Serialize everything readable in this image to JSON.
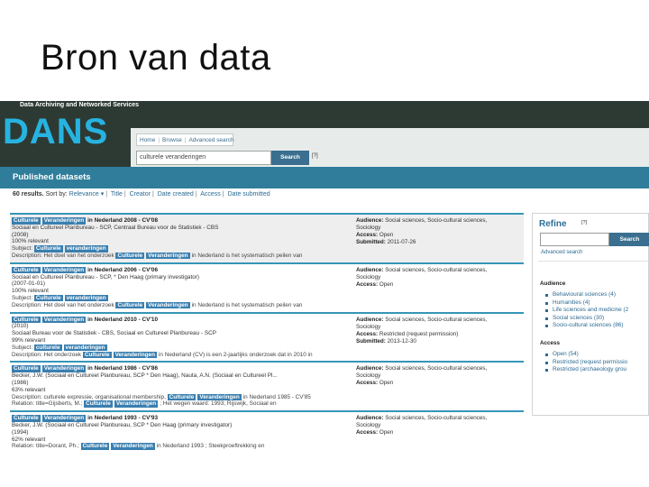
{
  "slide": {
    "title": "Bron van data"
  },
  "app": {
    "tagline": "Data Archiving and Networked Services",
    "logo": "DANS",
    "nav": {
      "home": "Home",
      "browse": "Browse",
      "advanced": "Advanced search"
    },
    "search": {
      "value": "culturele veranderingen",
      "button": "Search",
      "help": "[?]"
    }
  },
  "published": {
    "header": "Published datasets",
    "results_count": "60 results.",
    "sort_label": "Sort by:",
    "sort_options": [
      "Relevance ▾",
      "Title",
      "Creator",
      "Date created",
      "Access",
      "Date submitted"
    ]
  },
  "results": [
    {
      "alt": true,
      "title_tags": [
        "Culturele",
        "Veranderingen"
      ],
      "title_rest": "in Nederland 2008 - CV'08",
      "lines": [
        "Sociaal en Cultureel Planbureau - SCP, Centraal Bureau voor de Statistiek - CBS",
        "(2008)",
        "100% relevant"
      ],
      "subject_label": "Subject:",
      "subject_tags": [
        "Culturele",
        "veranderingen"
      ],
      "desc_label": "Description: Het doel van het onderzoek",
      "desc_tags": [
        "Culturele",
        "Veranderingen"
      ],
      "desc_rest": "in Nederland is het systematisch peilen van",
      "audience": "Social sciences, Socio-cultural sciences,",
      "audience2": "Sociology",
      "access": "Open",
      "submitted": "2011-07-26"
    },
    {
      "alt": false,
      "title_tags": [
        "Culturele",
        "Veranderingen"
      ],
      "title_rest": "in Nederland 2006 - CV'06",
      "lines": [
        "Sociaal en Cultureel Planbureau - SCP, * Den Haag (primary investigator)",
        "(2007-01-01)",
        "100% relevant"
      ],
      "subject_label": "Subject:",
      "subject_tags": [
        "Culturele",
        "veranderingen"
      ],
      "desc_label": "Description: Het doel van het onderzoek",
      "desc_tags": [
        "Culturele",
        "Veranderingen"
      ],
      "desc_rest": "in Nederland is het systematisch peilen van",
      "audience": "Social sciences, Socio-cultural sciences,",
      "audience2": "Sociology",
      "access": "Open",
      "submitted": ""
    },
    {
      "alt": false,
      "title_tags": [
        "Culturele",
        "Veranderingen"
      ],
      "title_rest": "in Nederland 2010 - CV'10",
      "lines": [
        "(2010)",
        "Sociaal Bureau voor de Statistiek - CBS, Sociaal en Cultureel Planbureau - SCP",
        "",
        "99% relevant"
      ],
      "subject_label": "Subject:",
      "subject_tags": [
        "culturele",
        "veranderingen"
      ],
      "desc_label": "Description: Het onderzoek",
      "desc_tags": [
        "Culturele",
        "Veranderingen"
      ],
      "desc_rest": "in Nederland (CV) is een 2-jaarlijks onderzoek dat in 2010 in",
      "audience": "Social sciences, Socio-cultural sciences,",
      "audience2": "Sociology",
      "access": "Restricted (request permission)",
      "submitted": "2013-12-30"
    },
    {
      "alt": false,
      "title_tags": [
        "Culturele",
        "Veranderingen"
      ],
      "title_rest": "in Nederland 1986 - CV'86",
      "lines": [
        "Becker, J.W. (Sociaal en Cultureel Planbureau, SCP * Den Haag), Nauta, A.N. (Sociaal en Cultureel Pl...",
        "(1986)",
        "63% relevant"
      ],
      "subject_label": "Description: culturele expressie, organisational membership,",
      "subject_tags": [
        "Culturele",
        "Veranderingen"
      ],
      "subject_rest": "in Nederland 1985 - CV'85",
      "desc_label": "Relation: title=Gijsberts, M.;",
      "desc_tags": [
        "Culturele",
        "Veranderingen"
      ],
      "desc_rest": "; Het wegen waard: 1993; Rijswijk, Sociaal en",
      "audience": "Social sciences, Socio-cultural sciences,",
      "audience2": "Sociology",
      "access": "Open",
      "submitted": ""
    },
    {
      "alt": false,
      "title_tags": [
        "Culturele",
        "Veranderingen"
      ],
      "title_rest": "in Nederland 1993 - CV'93",
      "lines": [
        "Becker, J.W. (Sociaal en Cultureel Planbureau, SCP * Den Haag (primary investigator)",
        "(1994)",
        "62% relevant"
      ],
      "subject_label": "Relation: title=Dorant, Ph.;",
      "subject_tags": [
        "Culturele",
        "Veranderingen"
      ],
      "subject_rest": "in Nederland 1993 ; Steekproeftrekking en",
      "desc_label": "",
      "desc_tags": [],
      "desc_rest": "",
      "audience": "Social sciences, Socio-cultural sciences,",
      "audience2": "Sociology",
      "access": "Open",
      "submitted": ""
    }
  ],
  "labels": {
    "audience": "Audience:",
    "access": "Access:",
    "submitted": "Submitted:"
  },
  "sidebar": {
    "refine": "Refine",
    "help": "[?]",
    "button": "Search",
    "advanced": "Advanced search",
    "audience_head": "Audience",
    "audience_items": [
      "Behavioural sciences (4)",
      "Humanities (4)",
      "Life sciences and medicine (2",
      "Social sciences (30)",
      "Socio-cultural sciences (86)"
    ],
    "access_head": "Access",
    "access_items": [
      "Open (54)",
      "Restricted (request permissio",
      "Restricted (archaeology grou"
    ]
  }
}
